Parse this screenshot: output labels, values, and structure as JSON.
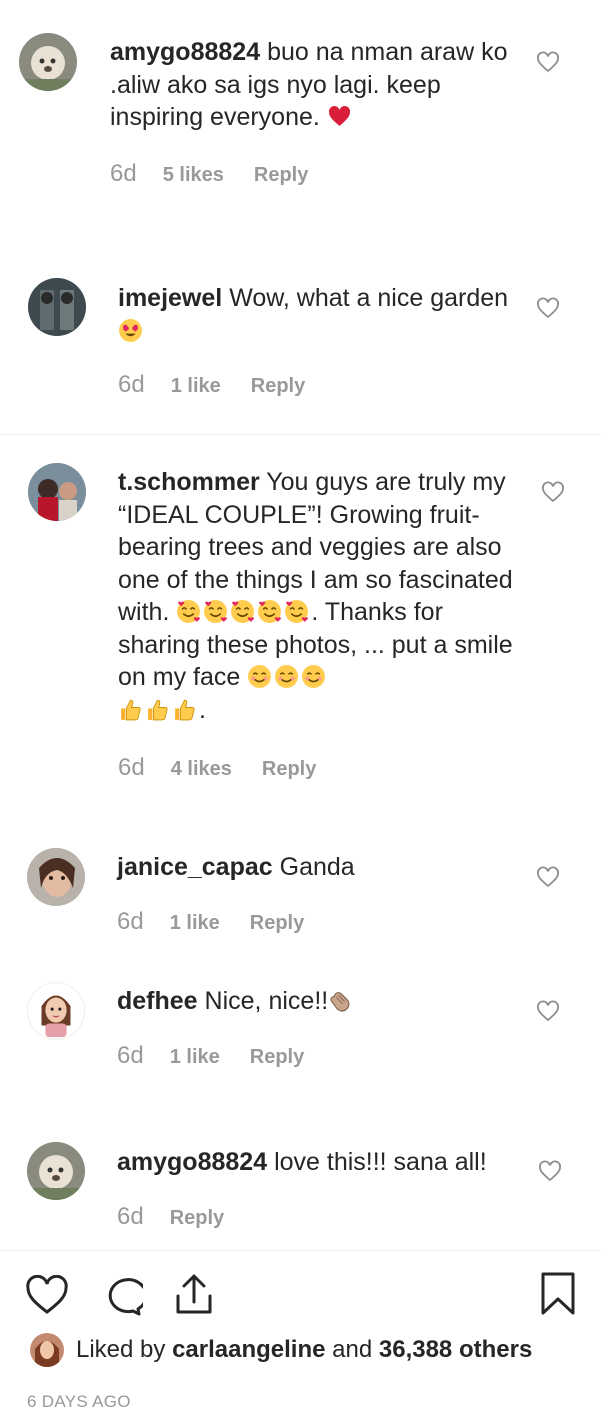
{
  "comments": [
    {
      "username": "amygo88824",
      "text": "buo na nman araw ko .aliw ako sa igs nyo lagi. keep inspiring everyone.",
      "emoji_trailing": "red-heart",
      "age": "6d",
      "likes": "5 likes",
      "reply": "Reply"
    },
    {
      "username": "imejewel",
      "text": "Wow, what a nice garden",
      "emoji_trailing": "heart-eyes",
      "age": "6d",
      "likes": "1 like",
      "reply": "Reply"
    },
    {
      "username": "t.schommer",
      "text_part1": "You guys are truly my “IDEAL COUPLE”! Growing fruit-bearing trees and veggies are also one of the things I am so fascinated with.",
      "text_part2": ". Thanks for sharing these photos, ... put a smile on my face",
      "text_part3": ".",
      "emoji_group1": "smiling-hearts x5",
      "emoji_group2": "smiling-blush x3",
      "emoji_group3": "thumbs-up x3",
      "age": "6d",
      "likes": "4 likes",
      "reply": "Reply"
    },
    {
      "username": "janice_capac",
      "text": "Ganda",
      "age": "6d",
      "likes": "1 like",
      "reply": "Reply"
    },
    {
      "username": "defhee",
      "text": "Nice, nice!!",
      "emoji_trailing": "clapping-hands",
      "age": "6d",
      "likes": "1 like",
      "reply": "Reply"
    },
    {
      "username": "amygo88824",
      "text": "love this!!! sana all!",
      "age": "6d",
      "reply": "Reply"
    }
  ],
  "footer": {
    "liked_prefix": "Liked by",
    "liked_user": "carlaangeline",
    "liked_mid": "and",
    "liked_others": "36,388 others",
    "posted_ago": "6 DAYS AGO"
  },
  "icons": {
    "like": "heart-outline-icon",
    "comment": "comment-bubble-icon",
    "share": "share-upload-icon",
    "save": "bookmark-icon"
  },
  "colors": {
    "text": "#262626",
    "muted": "#999999",
    "divider": "#efefef",
    "heart_red": "#e0245e"
  }
}
